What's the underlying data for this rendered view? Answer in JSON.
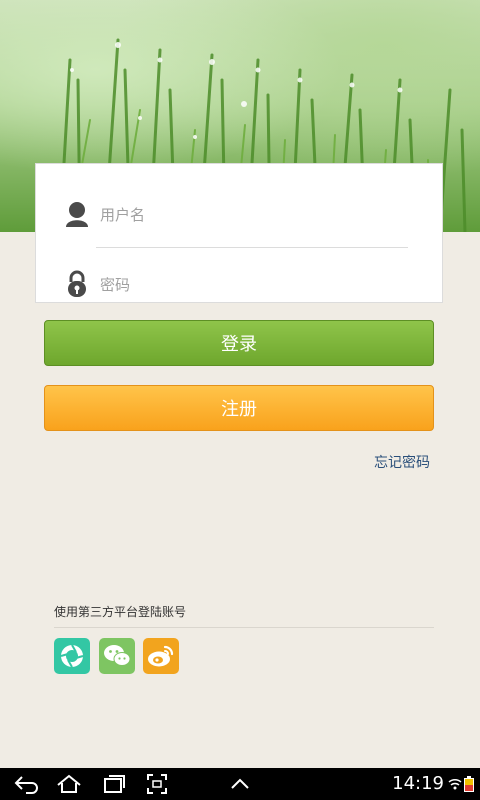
{
  "login": {
    "username_placeholder": "用户名",
    "password_placeholder": "密码",
    "username_value": "",
    "password_value": ""
  },
  "buttons": {
    "login_label": "登录",
    "register_label": "注册"
  },
  "links": {
    "forgot_password": "忘记密码"
  },
  "third_party": {
    "title": "使用第三方平台登陆账号",
    "icons": [
      "camera-shutter-icon",
      "wechat-icon",
      "weibo-icon"
    ]
  },
  "system_bar": {
    "time": "14:19",
    "icons": [
      "back-icon",
      "home-icon",
      "recent-apps-icon",
      "screenshot-icon",
      "up-arrow-icon",
      "wifi-icon",
      "battery-icon"
    ]
  },
  "colors": {
    "login_button": "#7ab43a",
    "register_button": "#fdb032",
    "link": "#2a4f7a",
    "background": "#f0ece4"
  }
}
